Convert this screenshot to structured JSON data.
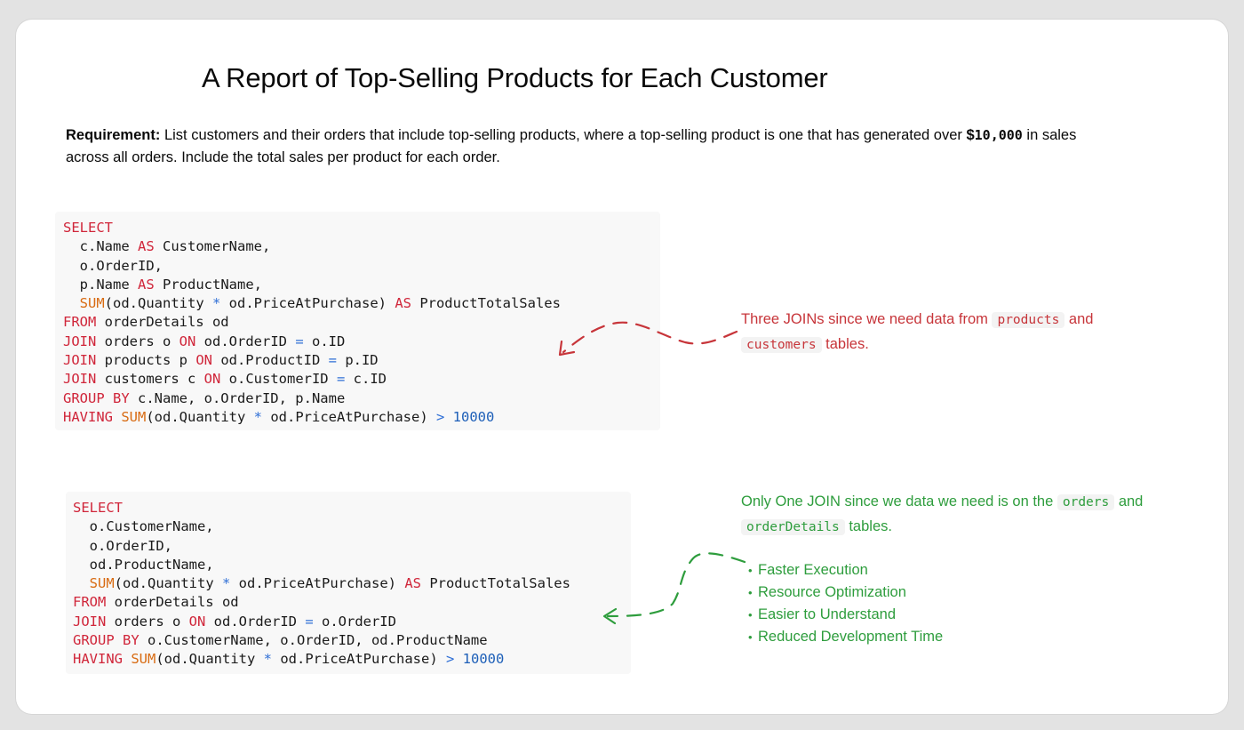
{
  "title": "A Report of Top-Selling Products for Each Customer",
  "requirement": {
    "label": "Requirement:",
    "text_before": " List customers and their orders that include top-selling products, where a top-selling product is one that has generated over ",
    "money_symbol": "$",
    "money_value": "10,000",
    "text_after": " in sales across all orders. Include the total sales per product for each order."
  },
  "query1": {
    "lines": [
      [
        {
          "t": "SELECT",
          "c": "kw"
        }
      ],
      [
        {
          "t": "  c.Name "
        },
        {
          "t": "AS",
          "c": "kw"
        },
        {
          "t": " CustomerName,"
        }
      ],
      [
        {
          "t": "  o.OrderID,"
        }
      ],
      [
        {
          "t": "  p.Name "
        },
        {
          "t": "AS",
          "c": "kw"
        },
        {
          "t": " ProductName,"
        }
      ],
      [
        {
          "t": "  "
        },
        {
          "t": "SUM",
          "c": "fn"
        },
        {
          "t": "(od.Quantity "
        },
        {
          "t": "*",
          "c": "op"
        },
        {
          "t": " od.PriceAtPurchase) "
        },
        {
          "t": "AS",
          "c": "kw"
        },
        {
          "t": " ProductTotalSales"
        }
      ],
      [
        {
          "t": "FROM",
          "c": "kw"
        },
        {
          "t": " orderDetails od"
        }
      ],
      [
        {
          "t": "JOIN",
          "c": "kw"
        },
        {
          "t": " orders o "
        },
        {
          "t": "ON",
          "c": "kw"
        },
        {
          "t": " od.OrderID "
        },
        {
          "t": "=",
          "c": "op"
        },
        {
          "t": " o.ID"
        }
      ],
      [
        {
          "t": "JOIN",
          "c": "kw"
        },
        {
          "t": " products p "
        },
        {
          "t": "ON",
          "c": "kw"
        },
        {
          "t": " od.ProductID "
        },
        {
          "t": "=",
          "c": "op"
        },
        {
          "t": " p.ID"
        }
      ],
      [
        {
          "t": "JOIN",
          "c": "kw"
        },
        {
          "t": " customers c "
        },
        {
          "t": "ON",
          "c": "kw"
        },
        {
          "t": " o.CustomerID "
        },
        {
          "t": "=",
          "c": "op"
        },
        {
          "t": " c.ID"
        }
      ],
      [
        {
          "t": "GROUP BY",
          "c": "kw"
        },
        {
          "t": " c.Name, o.OrderID, p.Name"
        }
      ],
      [
        {
          "t": "HAVING",
          "c": "kw"
        },
        {
          "t": " "
        },
        {
          "t": "SUM",
          "c": "fn"
        },
        {
          "t": "(od.Quantity "
        },
        {
          "t": "*",
          "c": "op"
        },
        {
          "t": " od.PriceAtPurchase) "
        },
        {
          "t": ">",
          "c": "op"
        },
        {
          "t": " "
        },
        {
          "t": "10000",
          "c": "num"
        }
      ]
    ]
  },
  "query2": {
    "lines": [
      [
        {
          "t": "SELECT",
          "c": "kw"
        }
      ],
      [
        {
          "t": "  o.CustomerName,"
        }
      ],
      [
        {
          "t": "  o.OrderID,"
        }
      ],
      [
        {
          "t": "  od.ProductName,"
        }
      ],
      [
        {
          "t": "  "
        },
        {
          "t": "SUM",
          "c": "fn"
        },
        {
          "t": "(od.Quantity "
        },
        {
          "t": "*",
          "c": "op"
        },
        {
          "t": " od.PriceAtPurchase) "
        },
        {
          "t": "AS",
          "c": "kw"
        },
        {
          "t": " ProductTotalSales"
        }
      ],
      [
        {
          "t": "FROM",
          "c": "kw"
        },
        {
          "t": " orderDetails od"
        }
      ],
      [
        {
          "t": "JOIN",
          "c": "kw"
        },
        {
          "t": " orders o "
        },
        {
          "t": "ON",
          "c": "kw"
        },
        {
          "t": " od.OrderID "
        },
        {
          "t": "=",
          "c": "op"
        },
        {
          "t": " o.OrderID"
        }
      ],
      [
        {
          "t": "GROUP BY",
          "c": "kw"
        },
        {
          "t": " o.CustomerName, o.OrderID, od.ProductName"
        }
      ],
      [
        {
          "t": "HAVING",
          "c": "kw"
        },
        {
          "t": " "
        },
        {
          "t": "SUM",
          "c": "fn"
        },
        {
          "t": "(od.Quantity "
        },
        {
          "t": "*",
          "c": "op"
        },
        {
          "t": " od.PriceAtPurchase) "
        },
        {
          "t": ">",
          "c": "op"
        },
        {
          "t": " "
        },
        {
          "t": "10000",
          "c": "num"
        }
      ]
    ]
  },
  "note1": {
    "text1": "Three JOINs since we need data from ",
    "chip1": "products",
    "text2": " and ",
    "chip2": "customers",
    "text3": " tables."
  },
  "note2": {
    "text1": "Only One JOIN since we data we need is on the ",
    "chip1": "orders",
    "text2": " and ",
    "chip2": "orderDetails",
    "text3": " tables."
  },
  "benefits": [
    "Faster Execution",
    "Resource Optimization",
    "Easier to Understand",
    "Reduced Development Time"
  ],
  "colors": {
    "keyword": "#d0263a",
    "function": "#d86b12",
    "operator": "#2f6fd6",
    "number": "#1d5fb8",
    "note_red": "#c7353a",
    "note_green": "#2e9d3d"
  }
}
